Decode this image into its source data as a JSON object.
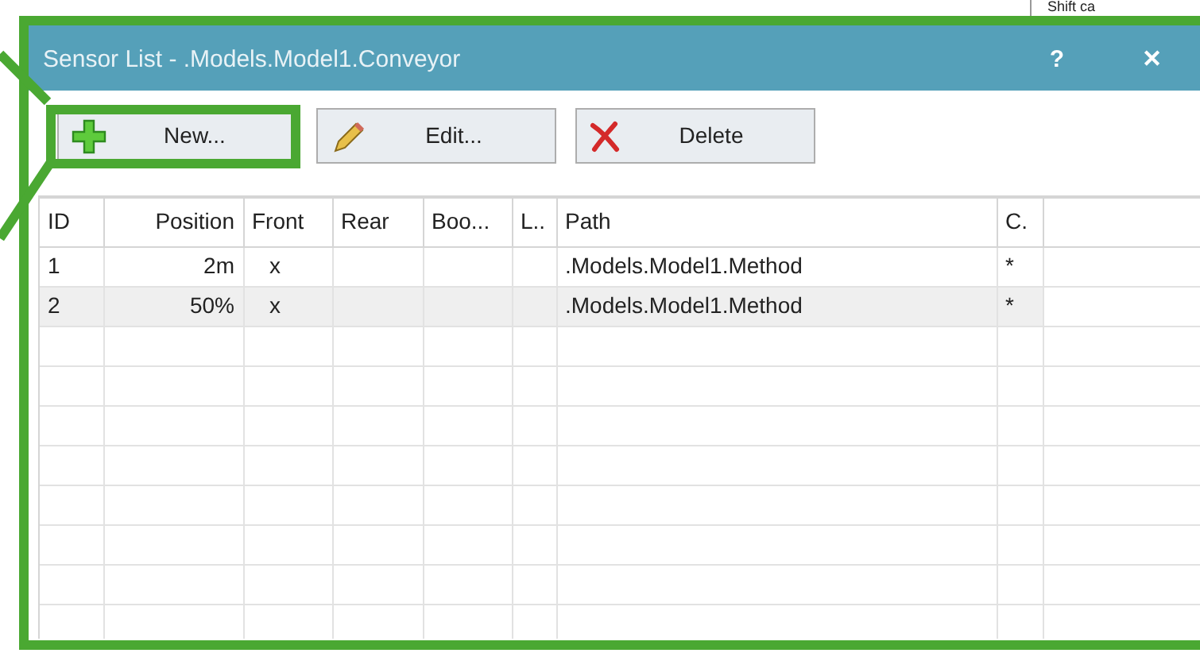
{
  "background": {
    "text": "Shift ca"
  },
  "window": {
    "title": "Sensor List - .Models.Model1.Conveyor",
    "help": "?",
    "close": "✕"
  },
  "toolbar": [
    {
      "kind": "new",
      "label": "New...",
      "highlighted": true
    },
    {
      "kind": "edit",
      "label": "Edit...",
      "highlighted": false
    },
    {
      "kind": "delete",
      "label": "Delete",
      "highlighted": false
    }
  ],
  "table": {
    "columns": [
      "ID",
      "Position",
      "Front",
      "Rear",
      "Boo...",
      "L..",
      "Path",
      "C."
    ],
    "rows": [
      {
        "selected": false,
        "cells": [
          "1",
          "2m",
          "x",
          "",
          "",
          "",
          ".Models.Model1.Method",
          "*"
        ]
      },
      {
        "selected": true,
        "cells": [
          "2",
          "50%",
          "x",
          "",
          "",
          "",
          ".Models.Model1.Method",
          "*"
        ]
      }
    ]
  }
}
